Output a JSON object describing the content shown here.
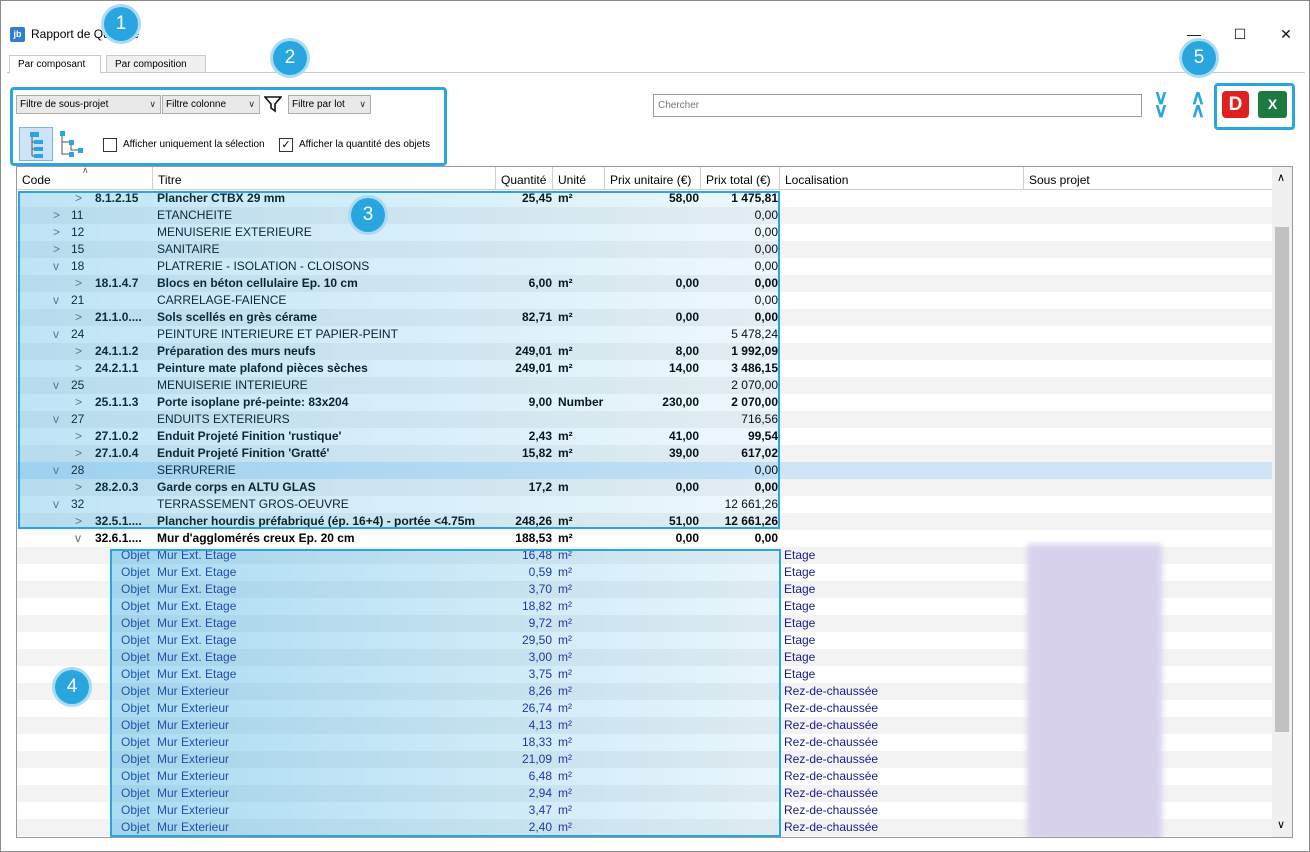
{
  "window": {
    "title": "Rapport de Quantité",
    "icon_text": "jb"
  },
  "tabs": [
    {
      "label": "Par composant"
    },
    {
      "label": "Par composition"
    }
  ],
  "filters": {
    "subproject": "Filtre de sous-projet",
    "column": "Filtre colonne",
    "lot": "Filtre par lot",
    "only_selection": "Afficher uniquement la sélection",
    "show_object_qty": "Afficher la quantité des objets",
    "only_selection_checked": false,
    "show_object_qty_checked": true
  },
  "search": {
    "placeholder": "Chercher"
  },
  "export": {
    "pdf_label": "D",
    "excel_label": "X"
  },
  "columns": [
    "Code",
    "Titre",
    "Quantité",
    "Unité",
    "Prix unitaire (€)",
    "Prix total (€)",
    "Localisation",
    "Sous projet"
  ],
  "rows": [
    {
      "exp": ">",
      "code": "8.1.2.15",
      "title": "Plancher CTBX 29 mm",
      "qty": "25,45",
      "unit": "m²",
      "pu": "58,00",
      "pt": "1 475,81",
      "kind": "item"
    },
    {
      "exp": ">",
      "code": "11",
      "title": "ETANCHEITE",
      "qty": "",
      "unit": "",
      "pu": "",
      "pt": "0,00",
      "kind": "group"
    },
    {
      "exp": ">",
      "code": "12",
      "title": "MENUISERIE EXTERIEURE",
      "qty": "",
      "unit": "",
      "pu": "",
      "pt": "0,00",
      "kind": "group"
    },
    {
      "exp": ">",
      "code": "15",
      "title": "SANITAIRE",
      "qty": "",
      "unit": "",
      "pu": "",
      "pt": "0,00",
      "kind": "group"
    },
    {
      "exp": "v",
      "code": "18",
      "title": "PLATRERIE - ISOLATION - CLOISONS",
      "qty": "",
      "unit": "",
      "pu": "",
      "pt": "0,00",
      "kind": "group"
    },
    {
      "exp": ">",
      "code": "18.1.4.7",
      "title": "Blocs en béton cellulaire Ep. 10 cm",
      "qty": "6,00",
      "unit": "m²",
      "pu": "0,00",
      "pt": "0,00",
      "kind": "item"
    },
    {
      "exp": "v",
      "code": "21",
      "title": "CARRELAGE-FAIENCE",
      "qty": "",
      "unit": "",
      "pu": "",
      "pt": "0,00",
      "kind": "group"
    },
    {
      "exp": ">",
      "code": "21.1.0....",
      "title": "Sols scellés en grès cérame",
      "qty": "82,71",
      "unit": "m²",
      "pu": "0,00",
      "pt": "0,00",
      "kind": "item"
    },
    {
      "exp": "v",
      "code": "24",
      "title": "PEINTURE INTERIEURE ET PAPIER-PEINT",
      "qty": "",
      "unit": "",
      "pu": "",
      "pt": "5 478,24",
      "kind": "group"
    },
    {
      "exp": ">",
      "code": "24.1.1.2",
      "title": "Préparation des murs neufs",
      "qty": "249,01",
      "unit": "m²",
      "pu": "8,00",
      "pt": "1 992,09",
      "kind": "item"
    },
    {
      "exp": ">",
      "code": "24.2.1.1",
      "title": "Peinture mate plafond pièces sèches",
      "qty": "249,01",
      "unit": "m²",
      "pu": "14,00",
      "pt": "3 486,15",
      "kind": "item"
    },
    {
      "exp": "v",
      "code": "25",
      "title": "MENUISERIE INTERIEURE",
      "qty": "",
      "unit": "",
      "pu": "",
      "pt": "2 070,00",
      "kind": "group"
    },
    {
      "exp": ">",
      "code": "25.1.1.3",
      "title": "Porte isoplane pré-peinte: 83x204",
      "qty": "9,00",
      "unit": "Number",
      "pu": "230,00",
      "pt": "2 070,00",
      "kind": "item"
    },
    {
      "exp": "v",
      "code": "27",
      "title": "ENDUITS EXTERIEURS",
      "qty": "",
      "unit": "",
      "pu": "",
      "pt": "716,56",
      "kind": "group"
    },
    {
      "exp": ">",
      "code": "27.1.0.2",
      "title": "Enduit Projeté Finition 'rustique'",
      "qty": "2,43",
      "unit": "m²",
      "pu": "41,00",
      "pt": "99,54",
      "kind": "item"
    },
    {
      "exp": ">",
      "code": "27.1.0.4",
      "title": "Enduit Projeté Finition 'Gratté'",
      "qty": "15,82",
      "unit": "m²",
      "pu": "39,00",
      "pt": "617,02",
      "kind": "item"
    },
    {
      "exp": "v",
      "code": "28",
      "title": "SERRURERIE",
      "qty": "",
      "unit": "",
      "pu": "",
      "pt": "0,00",
      "kind": "group",
      "selected": true
    },
    {
      "exp": ">",
      "code": "28.2.0.3",
      "title": "Garde corps en ALTU GLAS",
      "qty": "17,2",
      "unit": "m",
      "pu": "0,00",
      "pt": "0,00",
      "kind": "item"
    },
    {
      "exp": "v",
      "code": "32",
      "title": "TERRASSEMENT GROS-OEUVRE",
      "qty": "",
      "unit": "",
      "pu": "",
      "pt": "12 661,26",
      "kind": "group"
    },
    {
      "exp": ">",
      "code": "32.5.1....",
      "title": "Plancher hourdis préfabriqué (ép. 16+4) - portée <4.75m",
      "qty": "248,26",
      "unit": "m²",
      "pu": "51,00",
      "pt": "12 661,26",
      "kind": "item"
    },
    {
      "exp": "v",
      "code": "32.6.1....",
      "title": "Mur d'agglomérés creux Ep. 20 cm",
      "qty": "188,53",
      "unit": "m²",
      "pu": "0,00",
      "pt": "0,00",
      "kind": "item"
    },
    {
      "code": "Objet",
      "title": "Mur Ext. Etage",
      "qty": "16,48",
      "unit": "m²",
      "loc": "Etage",
      "kind": "object"
    },
    {
      "code": "Objet",
      "title": "Mur Ext. Etage",
      "qty": "0,59",
      "unit": "m²",
      "loc": "Etage",
      "kind": "object"
    },
    {
      "code": "Objet",
      "title": "Mur Ext. Etage",
      "qty": "3,70",
      "unit": "m²",
      "loc": "Etage",
      "kind": "object"
    },
    {
      "code": "Objet",
      "title": "Mur Ext. Etage",
      "qty": "18,82",
      "unit": "m²",
      "loc": "Etage",
      "kind": "object"
    },
    {
      "code": "Objet",
      "title": "Mur Ext. Etage",
      "qty": "9,72",
      "unit": "m²",
      "loc": "Etage",
      "kind": "object"
    },
    {
      "code": "Objet",
      "title": "Mur Ext. Etage",
      "qty": "29,50",
      "unit": "m²",
      "loc": "Etage",
      "kind": "object"
    },
    {
      "code": "Objet",
      "title": "Mur Ext. Etage",
      "qty": "3,00",
      "unit": "m²",
      "loc": "Etage",
      "kind": "object"
    },
    {
      "code": "Objet",
      "title": "Mur Ext. Etage",
      "qty": "3,75",
      "unit": "m²",
      "loc": "Etage",
      "kind": "object"
    },
    {
      "code": "Objet",
      "title": "Mur Exterieur",
      "qty": "8,26",
      "unit": "m²",
      "loc": "Rez-de-chaussée",
      "kind": "object"
    },
    {
      "code": "Objet",
      "title": "Mur Exterieur",
      "qty": "26,74",
      "unit": "m²",
      "loc": "Rez-de-chaussée",
      "kind": "object"
    },
    {
      "code": "Objet",
      "title": "Mur Exterieur",
      "qty": "4,13",
      "unit": "m²",
      "loc": "Rez-de-chaussée",
      "kind": "object"
    },
    {
      "code": "Objet",
      "title": "Mur Exterieur",
      "qty": "18,33",
      "unit": "m²",
      "loc": "Rez-de-chaussée",
      "kind": "object"
    },
    {
      "code": "Objet",
      "title": "Mur Exterieur",
      "qty": "21,09",
      "unit": "m²",
      "loc": "Rez-de-chaussée",
      "kind": "object"
    },
    {
      "code": "Objet",
      "title": "Mur Exterieur",
      "qty": "6,48",
      "unit": "m²",
      "loc": "Rez-de-chaussée",
      "kind": "object"
    },
    {
      "code": "Objet",
      "title": "Mur Exterieur",
      "qty": "2,94",
      "unit": "m²",
      "loc": "Rez-de-chaussée",
      "kind": "object"
    },
    {
      "code": "Objet",
      "title": "Mur Exterieur",
      "qty": "3,47",
      "unit": "m²",
      "loc": "Rez-de-chaussée",
      "kind": "object"
    },
    {
      "code": "Objet",
      "title": "Mur Exterieur",
      "qty": "2,40",
      "unit": "m²",
      "loc": "Rez-de-chaussée",
      "kind": "object"
    }
  ],
  "badges": [
    "1",
    "2",
    "3",
    "4",
    "5"
  ],
  "colors": {
    "accent": "#29a6df",
    "selected_row": "#cfe4f7",
    "object_text": "#1a1a8c"
  }
}
